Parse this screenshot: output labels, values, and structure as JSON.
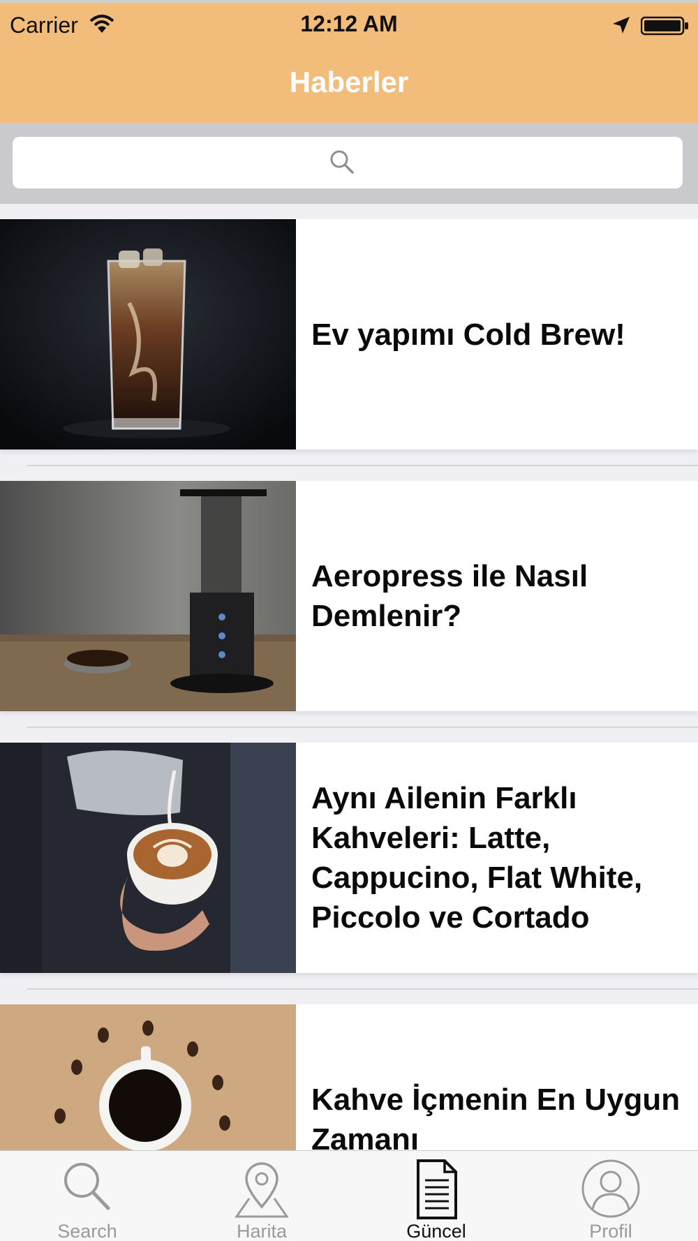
{
  "status_bar": {
    "carrier": "Carrier",
    "time": "12:12 AM"
  },
  "nav": {
    "title": "Haberler"
  },
  "search": {
    "placeholder": ""
  },
  "articles": [
    {
      "title": "Ev yapımı Cold Brew!",
      "image": "cold-brew-glass"
    },
    {
      "title": "Aeropress ile Nasıl Demlenir?",
      "image": "aeropress-brewer"
    },
    {
      "title": "Aynı Ailenin Farklı Kahveleri: Latte, Cappucino, Flat White, Piccolo ve Cortado",
      "image": "latte-art-pour"
    },
    {
      "title": "Kahve İçmenin En Uygun Zamanı",
      "image": "coffee-cup-with-beans"
    }
  ],
  "tabs": [
    {
      "label": "Search",
      "icon": "magnifier-icon",
      "active": false
    },
    {
      "label": "Harita",
      "icon": "map-pin-icon",
      "active": false
    },
    {
      "label": "Güncel",
      "icon": "document-icon",
      "active": true
    },
    {
      "label": "Profil",
      "icon": "person-icon",
      "active": false
    }
  ],
  "colors": {
    "header": "#f2bd7b",
    "title_text": "#ffffff",
    "tab_active": "#111111",
    "tab_inactive": "#9a9a9a"
  }
}
